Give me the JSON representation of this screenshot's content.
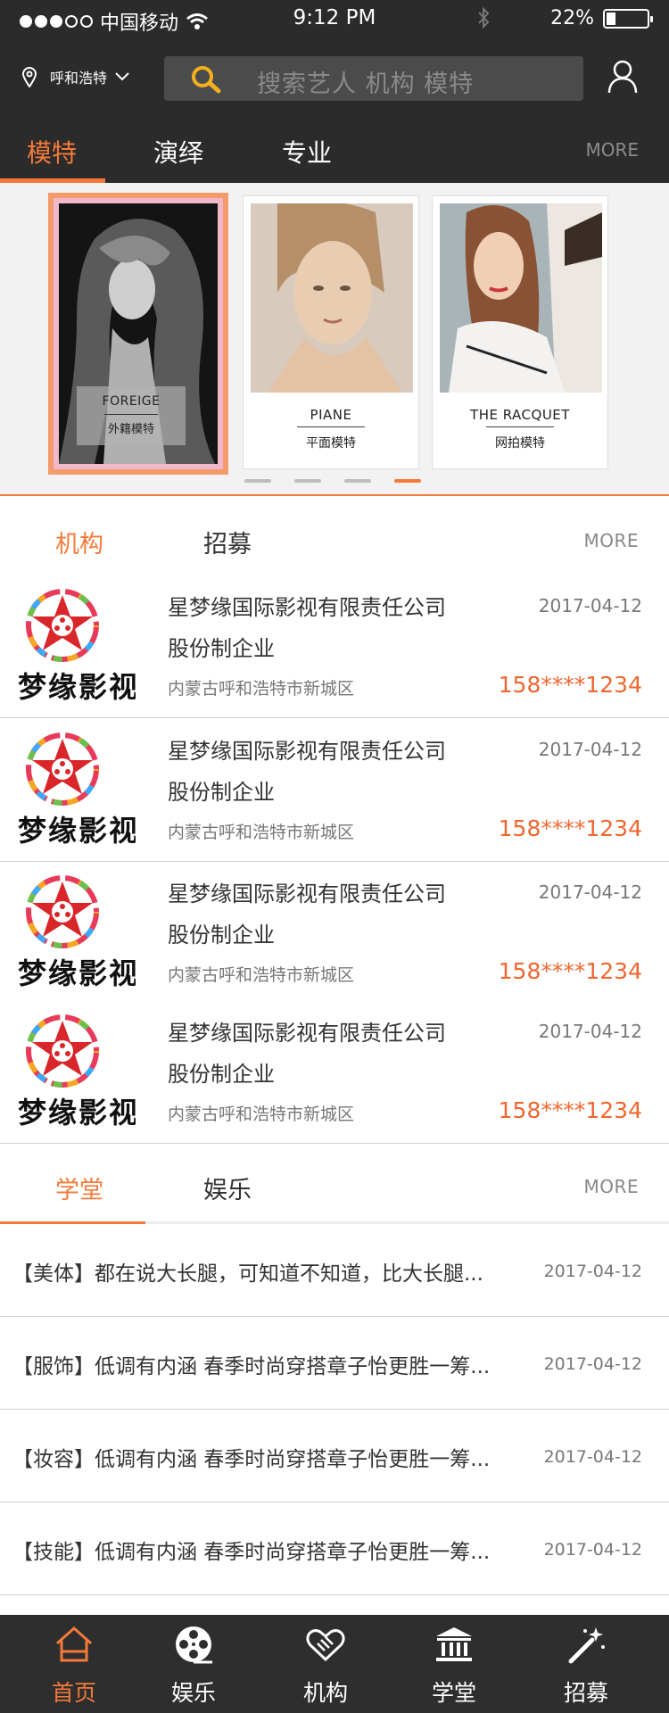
{
  "status_bar": {
    "carrier": "中国移动",
    "time": "9:12 PM",
    "battery": "22%",
    "battery_level": 0.22
  },
  "header": {
    "location": "呼和浩特",
    "search_placeholder": "搜索艺人  机构  模特",
    "category_tabs": [
      "模特",
      "演绎",
      "专业"
    ],
    "active_tab": 0,
    "more": "MORE"
  },
  "carousel": {
    "cards": [
      {
        "en": "FOREIGE",
        "zh": "外籍模特"
      },
      {
        "en": "PIANE",
        "zh": "平面模特"
      },
      {
        "en": "THE RACQUET",
        "zh": "网拍模特"
      }
    ],
    "pages": 4,
    "active_page": 3
  },
  "agency_section": {
    "tabs": [
      "机构",
      "招募"
    ],
    "more": "MORE",
    "logo_text": "梦缘影视",
    "items": [
      {
        "name": "星梦缘国际影视有限责任公司",
        "type": "股份制企业",
        "address": "内蒙古呼和浩特市新城区",
        "date": "2017-04-12",
        "phone": "158****1234"
      },
      {
        "name": "星梦缘国际影视有限责任公司",
        "type": "股份制企业",
        "address": "内蒙古呼和浩特市新城区",
        "date": "2017-04-12",
        "phone": "158****1234"
      },
      {
        "name": "星梦缘国际影视有限责任公司",
        "type": "股份制企业",
        "address": "内蒙古呼和浩特市新城区",
        "date": "2017-04-12",
        "phone": "158****1234"
      },
      {
        "name": "星梦缘国际影视有限责任公司",
        "type": "股份制企业",
        "address": "内蒙古呼和浩特市新城区",
        "date": "2017-04-12",
        "phone": "158****1234"
      }
    ]
  },
  "school_section": {
    "tabs": [
      "学堂",
      "娱乐"
    ],
    "more": "MORE",
    "articles": [
      {
        "title": "【美体】都在说大长腿，可知道不知道，比大长腿...",
        "date": "2017-04-12"
      },
      {
        "title": "【服饰】低调有内涵 春季时尚穿搭章子怡更胜一筹...",
        "date": "2017-04-12"
      },
      {
        "title": "【妆容】低调有内涵 春季时尚穿搭章子怡更胜一筹...",
        "date": "2017-04-12"
      },
      {
        "title": "【技能】低调有内涵 春季时尚穿搭章子怡更胜一筹...",
        "date": "2017-04-12"
      }
    ]
  },
  "tab_bar": {
    "items": [
      {
        "label": "首页",
        "icon": "home-icon"
      },
      {
        "label": "娱乐",
        "icon": "film-reel-icon"
      },
      {
        "label": "机构",
        "icon": "handshake-icon"
      },
      {
        "label": "学堂",
        "icon": "institution-icon"
      },
      {
        "label": "招募",
        "icon": "magic-wand-icon"
      }
    ],
    "active": 0
  },
  "colors": {
    "accent": "#f47a3a",
    "header_bg": "#2b2b2b",
    "phone": "#f0662e"
  }
}
